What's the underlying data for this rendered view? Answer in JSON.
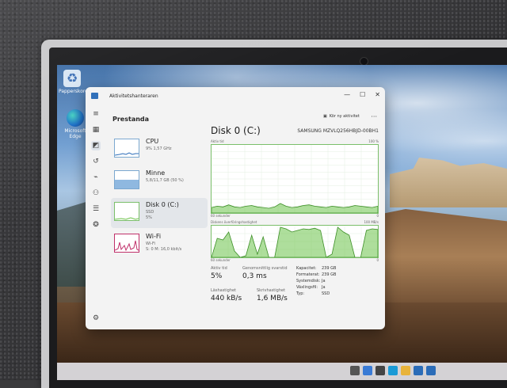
{
  "desktop": {
    "icons": [
      {
        "label": "Papperskorg"
      },
      {
        "label": "Microsoft Edge"
      }
    ]
  },
  "window": {
    "title": "Aktivitetshanteraren",
    "controls": [
      "—",
      "☐",
      "✕"
    ],
    "section": "Prestanda",
    "run_task": "Kör ny aktivitet",
    "more": "···"
  },
  "resources": [
    {
      "name": "CPU",
      "sub1": "9%  1,57 GHz",
      "sub2": ""
    },
    {
      "name": "Minne",
      "sub1": "5,8/11,7 GB (50 %)",
      "sub2": ""
    },
    {
      "name": "Disk 0 (C:)",
      "sub1": "SSD",
      "sub2": "5%"
    },
    {
      "name": "Wi-Fi",
      "sub1": "Wi-Fi",
      "sub2": "S: 0  M: 16,0 kbit/s"
    }
  ],
  "detail": {
    "title": "Disk 0 (C:)",
    "model": "SAMSUNG MZVLQ256HBJD-00BH1",
    "graph1_label": "Aktiv tid",
    "graph1_max": "100 %",
    "graph1_time": "60 sekunder",
    "graph1_min": "0",
    "graph2_label": "Diskens överföringshastighet",
    "graph2_max": "100 MB/s",
    "graph2_time": "60 sekunder",
    "graph2_min": "0",
    "stats": {
      "active_time_label": "Aktiv tid",
      "active_time_value": "5%",
      "response_label": "Genomsnittlig svarstid",
      "response_value": "0,3 ms",
      "read_label": "Läshastighet",
      "read_value": "440 kB/s",
      "write_label": "Skrivhastighet",
      "write_value": "1,6 MB/s",
      "capacity_label": "Kapacitet:",
      "capacity_value": "239 GB",
      "formatted_label": "Formaterat:",
      "formatted_value": "239 GB",
      "system_label": "Systemdisk:",
      "system_value": "Ja",
      "pagefile_label": "Växlingsfil:",
      "pagefile_value": "Ja",
      "type_label": "Typ:",
      "type_value": "SSD"
    }
  },
  "colors": {
    "disk_green": "#6cc24a",
    "memory_blue": "#8fb8e0",
    "wifi_pink": "#c0306a",
    "accent": "#2b6cb8"
  },
  "chart_data": {
    "type": "area",
    "series": [
      {
        "values": [
          8,
          10,
          9,
          12,
          9,
          8,
          10,
          11,
          9,
          8,
          7,
          9,
          14,
          10,
          8,
          9,
          11,
          12,
          10,
          9,
          8,
          10,
          9,
          8,
          9,
          11,
          10,
          9,
          8,
          10
        ]
      },
      {
        "values": [
          0,
          60,
          55,
          80,
          20,
          0,
          5,
          70,
          10,
          65,
          0,
          0,
          95,
          90,
          80,
          85,
          90,
          88,
          92,
          85,
          0,
          10,
          95,
          80,
          70,
          0,
          0,
          85,
          90,
          88
        ]
      }
    ],
    "ylim": [
      0,
      100
    ]
  }
}
